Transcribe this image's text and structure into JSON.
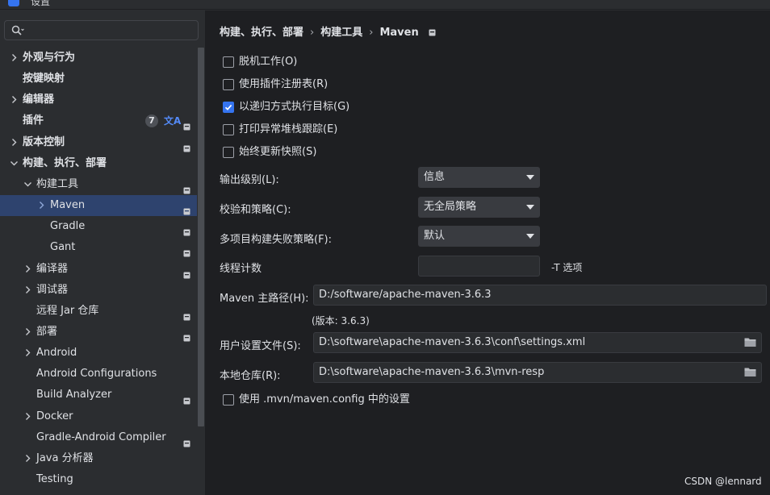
{
  "window": {
    "title": "设置"
  },
  "search": {
    "placeholder": ""
  },
  "sidebar": {
    "items": [
      {
        "label": "外观与行为",
        "expandable": true,
        "expanded": false,
        "indent": 0,
        "bold": true,
        "pinned": false
      },
      {
        "label": "按键映射",
        "expandable": false,
        "indent": 0,
        "bold": true,
        "pinned": false
      },
      {
        "label": "编辑器",
        "expandable": true,
        "expanded": false,
        "indent": 0,
        "bold": true,
        "pinned": false
      },
      {
        "label": "插件",
        "expandable": false,
        "indent": 0,
        "bold": true,
        "pinned": true,
        "badge": "7",
        "translate_icon": "文A"
      },
      {
        "label": "版本控制",
        "expandable": true,
        "expanded": false,
        "indent": 0,
        "bold": true,
        "pinned": true
      },
      {
        "label": "构建、执行、部署",
        "expandable": true,
        "expanded": true,
        "indent": 0,
        "bold": true,
        "pinned": false
      },
      {
        "label": "构建工具",
        "expandable": true,
        "expanded": true,
        "indent": 1,
        "bold": false,
        "pinned": true
      },
      {
        "label": "Maven",
        "expandable": true,
        "expanded": false,
        "indent": 2,
        "bold": false,
        "pinned": true,
        "selected": true
      },
      {
        "label": "Gradle",
        "expandable": false,
        "indent": 2,
        "bold": false,
        "pinned": true
      },
      {
        "label": "Gant",
        "expandable": false,
        "indent": 2,
        "bold": false,
        "pinned": true
      },
      {
        "label": "编译器",
        "expandable": true,
        "expanded": false,
        "indent": 1,
        "bold": false,
        "pinned": true
      },
      {
        "label": "调试器",
        "expandable": true,
        "expanded": false,
        "indent": 1,
        "bold": false,
        "pinned": false
      },
      {
        "label": "远程 Jar 仓库",
        "expandable": false,
        "indent": 1,
        "bold": false,
        "pinned": true
      },
      {
        "label": "部署",
        "expandable": true,
        "expanded": false,
        "indent": 1,
        "bold": false,
        "pinned": true
      },
      {
        "label": "Android",
        "expandable": true,
        "expanded": false,
        "indent": 1,
        "bold": false,
        "pinned": false
      },
      {
        "label": "Android Configurations",
        "expandable": false,
        "indent": 1,
        "bold": false,
        "pinned": false
      },
      {
        "label": "Build Analyzer",
        "expandable": false,
        "indent": 1,
        "bold": false,
        "pinned": true
      },
      {
        "label": "Docker",
        "expandable": true,
        "expanded": false,
        "indent": 1,
        "bold": false,
        "pinned": false
      },
      {
        "label": "Gradle-Android Compiler",
        "expandable": false,
        "indent": 1,
        "bold": false,
        "pinned": true
      },
      {
        "label": "Java 分析器",
        "expandable": true,
        "expanded": false,
        "indent": 1,
        "bold": false,
        "pinned": false
      },
      {
        "label": "Testing",
        "expandable": false,
        "indent": 1,
        "bold": false,
        "pinned": false
      }
    ]
  },
  "breadcrumb": [
    "构建、执行、部署",
    "构建工具",
    "Maven"
  ],
  "checkboxes": [
    {
      "label": "脱机工作(O)",
      "checked": false
    },
    {
      "label": "使用插件注册表(R)",
      "checked": false
    },
    {
      "label": "以递归方式执行目标(G)",
      "checked": true
    },
    {
      "label": "打印异常堆栈跟踪(E)",
      "checked": false
    },
    {
      "label": "始终更新快照(S)",
      "checked": false
    }
  ],
  "fields": {
    "output_level": {
      "label": "输出级别(L):",
      "value": "信息"
    },
    "checksum_policy": {
      "label": "校验和策略(C):",
      "value": "无全局策略"
    },
    "multiproject_fail": {
      "label": "多项目构建失败策略(F):",
      "value": "默认"
    },
    "thread_count": {
      "label": "线程计数",
      "value": "",
      "suffix": "-T 选项"
    },
    "maven_home": {
      "label": "Maven 主路径(H):",
      "value": "D:/software/apache-maven-3.6.3",
      "version_note": "(版本: 3.6.3)"
    },
    "user_settings": {
      "label": "用户设置文件(S):",
      "value": "D:\\software\\apache-maven-3.6.3\\conf\\settings.xml"
    },
    "local_repo": {
      "label": "本地仓库(R):",
      "value": "D:\\software\\apache-maven-3.6.3\\mvn-resp"
    }
  },
  "mvn_config_checkbox": {
    "label": "使用 .mvn/maven.config 中的设置",
    "checked": false
  },
  "watermark": "CSDN @lennard",
  "colors": {
    "accent": "#3574f0",
    "selection": "#2e436e",
    "panel": "#2b2d30",
    "content": "#1e1f22"
  }
}
